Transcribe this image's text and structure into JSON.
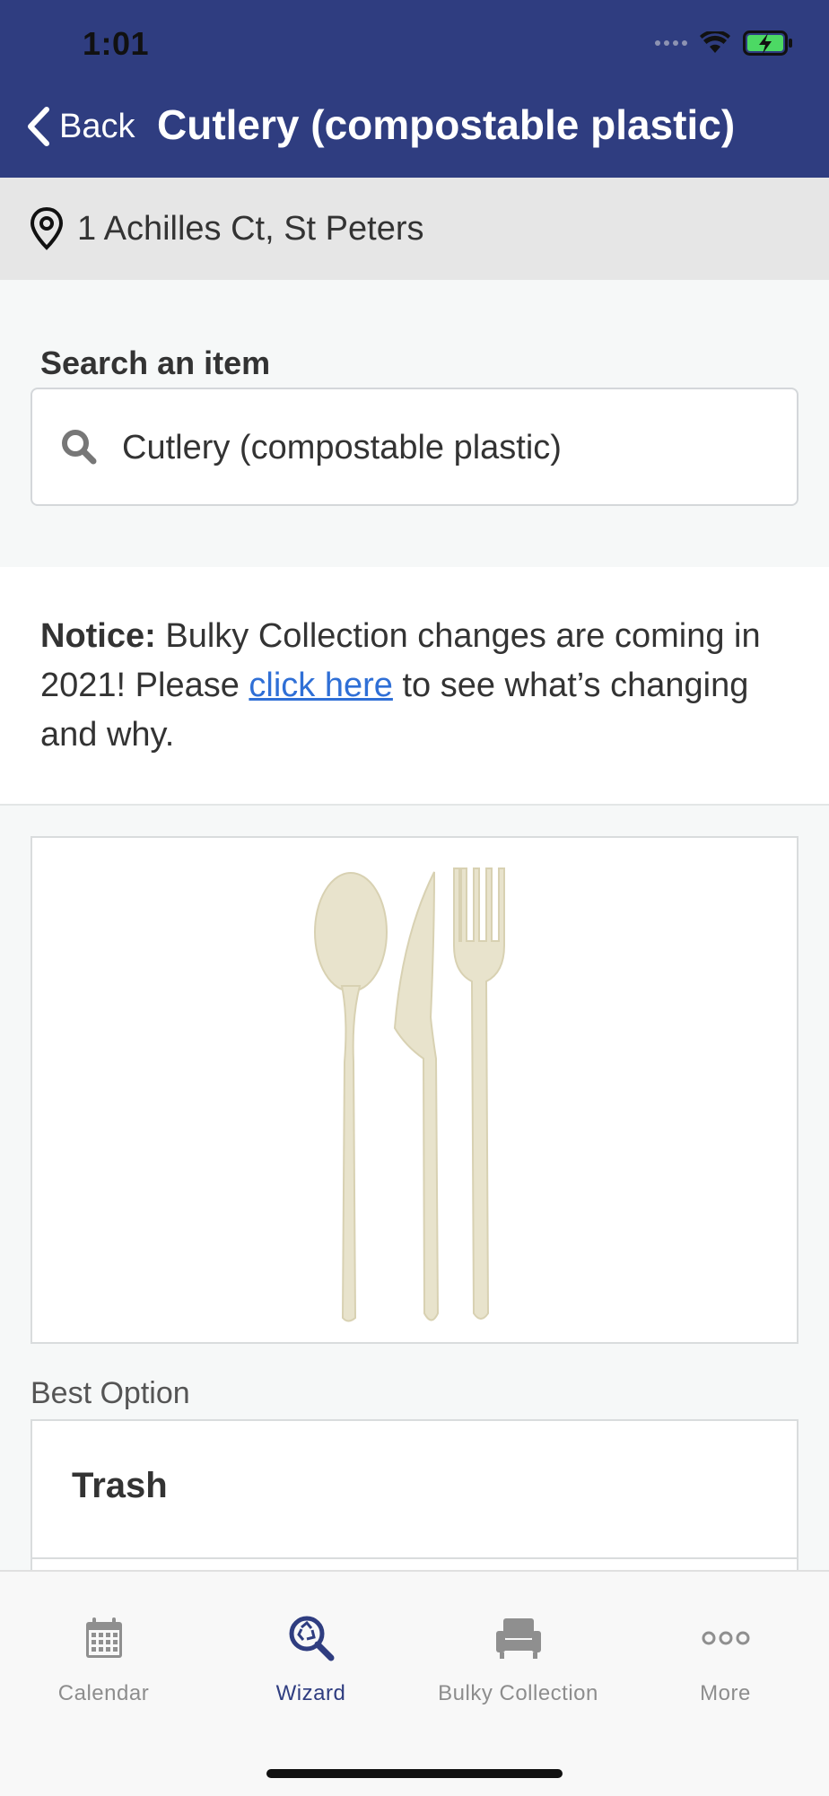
{
  "status_bar": {
    "time": "1:01"
  },
  "nav": {
    "back_label": "Back",
    "title": "Cutlery (compostable plastic)"
  },
  "location": {
    "address": "1 Achilles Ct, St Peters"
  },
  "search": {
    "label": "Search an item",
    "value": "Cutlery (compostable plastic)"
  },
  "notice": {
    "prefix": "Notice:",
    "text_before_link": " Bulky Collection changes are coming in 2021! Please ",
    "link_text": "click here",
    "text_after_link": " to see what’s changing and why."
  },
  "item_image": {
    "description": "compostable spoon, knife and fork"
  },
  "best_option": {
    "label": "Best Option",
    "value": "Trash"
  },
  "tabs": [
    {
      "label": "Calendar",
      "icon": "calendar-icon",
      "active": false
    },
    {
      "label": "Wizard",
      "icon": "wizard-search-icon",
      "active": true
    },
    {
      "label": "Bulky Collection",
      "icon": "armchair-icon",
      "active": false
    },
    {
      "label": "More",
      "icon": "more-dots-icon",
      "active": false
    }
  ],
  "colors": {
    "header": "#2f3d80",
    "active_tab": "#2f3d80",
    "link": "#2f6fd6",
    "battery": "#4cd964"
  }
}
